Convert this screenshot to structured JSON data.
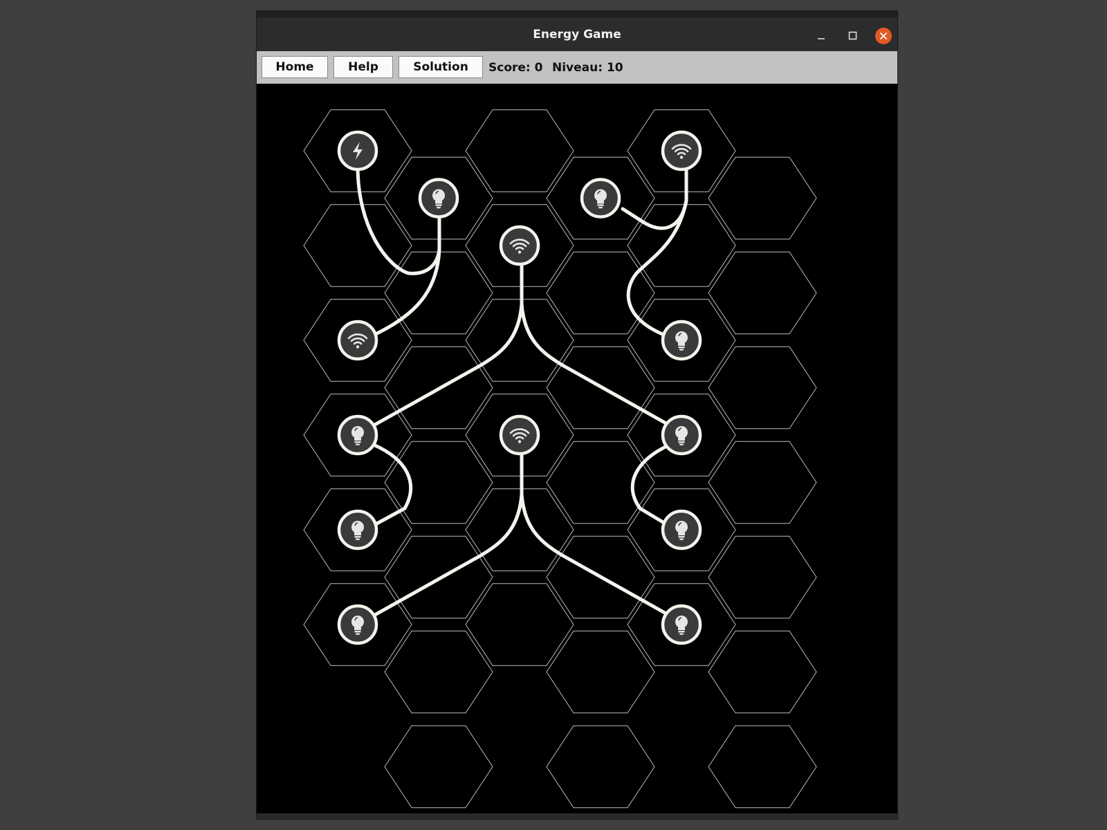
{
  "window": {
    "title": "Energy Game",
    "controls": [
      "minimize-icon",
      "maximize-icon",
      "close-icon"
    ],
    "close_color": "#e05a26"
  },
  "toolbar": {
    "home_label": "Home",
    "help_label": "Help",
    "solution_label": "Solution",
    "score_text": "Score: 0",
    "level_text": "Niveau: 10"
  },
  "board": {
    "columns": 6,
    "rows": 7,
    "tile_shape": "hexagon",
    "wire_color": "#f4f4ee",
    "components": [
      {
        "id": "c0r0",
        "type": "source",
        "icon": "lightning-icon"
      },
      {
        "id": "c1r0",
        "type": "lamp",
        "icon": "lightbulb-icon"
      },
      {
        "id": "c2r1",
        "type": "transmitter",
        "icon": "wifi-icon"
      },
      {
        "id": "c3r0",
        "type": "lamp",
        "icon": "lightbulb-icon"
      },
      {
        "id": "c4r0",
        "type": "transmitter",
        "icon": "wifi-icon"
      },
      {
        "id": "c0r2",
        "type": "transmitter",
        "icon": "wifi-icon"
      },
      {
        "id": "c4r2",
        "type": "lamp",
        "icon": "lightbulb-icon"
      },
      {
        "id": "c0r3",
        "type": "lamp",
        "icon": "lightbulb-icon"
      },
      {
        "id": "c2r3",
        "type": "transmitter",
        "icon": "wifi-icon"
      },
      {
        "id": "c4r3",
        "type": "lamp",
        "icon": "lightbulb-icon"
      },
      {
        "id": "c0r4",
        "type": "lamp",
        "icon": "lightbulb-icon"
      },
      {
        "id": "c4r4",
        "type": "lamp",
        "icon": "lightbulb-icon"
      },
      {
        "id": "c0r5",
        "type": "lamp",
        "icon": "lightbulb-icon"
      },
      {
        "id": "c4r5",
        "type": "lamp",
        "icon": "lightbulb-icon"
      }
    ]
  }
}
